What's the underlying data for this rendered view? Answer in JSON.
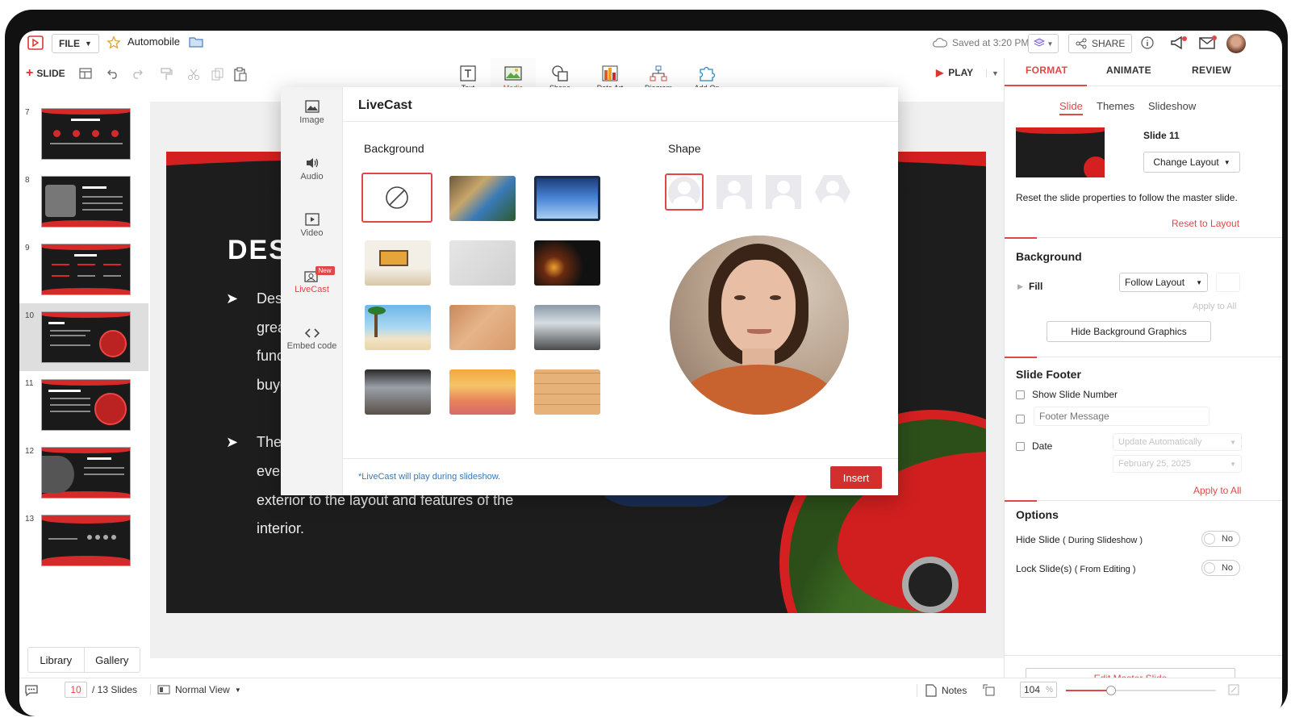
{
  "app": {
    "file_label": "FILE",
    "presentation_title": "Automobile",
    "saved_status": "Saved at 3:20 PM",
    "share_label": "SHARE"
  },
  "toolbar": {
    "slide_label": "SLIDE",
    "insert_tools": [
      {
        "label": "Text",
        "icon": "text-box-icon"
      },
      {
        "label": "Media",
        "icon": "image-icon"
      },
      {
        "label": "Shape",
        "icon": "shape-icon"
      },
      {
        "label": "Data Art",
        "icon": "data-art-icon"
      },
      {
        "label": "Diagram",
        "icon": "diagram-icon"
      },
      {
        "label": "Add-On",
        "icon": "puzzle-icon"
      }
    ],
    "play_label": "PLAY"
  },
  "panel": {
    "tabs": [
      "FORMAT",
      "ANIMATE",
      "REVIEW"
    ],
    "subtabs": [
      "Slide",
      "Themes",
      "Slideshow"
    ],
    "slide_name": "Slide 11",
    "change_layout": "Change Layout",
    "reset_text": "Reset the slide properties to follow the master slide.",
    "reset_link": "Reset to Layout",
    "background_title": "Background",
    "fill_label": "Fill",
    "fill_value": "Follow Layout",
    "apply_all": "Apply to All",
    "hide_bg_graphics": "Hide Background Graphics",
    "footer_title": "Slide Footer",
    "show_slide_number": "Show Slide Number",
    "footer_message_placeholder": "Footer Message",
    "date_label": "Date",
    "date_mode": "Update Automatically",
    "date_value": "February 25, 2025",
    "apply_all_2": "Apply to All",
    "options_title": "Options",
    "hide_slide": "Hide Slide",
    "hide_slide_note": "( During Slideshow )",
    "lock_slide": "Lock Slide(s)",
    "lock_slide_note": "( From Editing )",
    "toggle_no": "No",
    "edit_master": "Edit Master Slide"
  },
  "thumbnails": [
    "7",
    "8",
    "9",
    "10",
    "11",
    "12",
    "13"
  ],
  "slide": {
    "title": "DESI",
    "lines_a": [
      "Des",
      "grea",
      "func",
      "buye"
    ],
    "lines_b": [
      "The",
      "ever",
      "exterior to the layout and features of the",
      "interior."
    ]
  },
  "dialog": {
    "title": "LiveCast",
    "side": [
      {
        "label": "Image",
        "icon": "image-icon"
      },
      {
        "label": "Audio",
        "icon": "speaker-icon"
      },
      {
        "label": "Video",
        "icon": "video-icon"
      },
      {
        "label": "LiveCast",
        "icon": "livecast-icon",
        "badge": "New"
      },
      {
        "label": "Embed code",
        "icon": "code-icon"
      }
    ],
    "background_label": "Background",
    "shape_label": "Shape",
    "note": "*LiveCast will play during slideshow.",
    "insert_label": "Insert"
  },
  "status": {
    "current_slide": "10",
    "total_slides": "/ 13 Slides",
    "view_mode": "Normal View",
    "notes_label": "Notes",
    "zoom": "104",
    "zoom_unit": "%",
    "zoom_level_fraction": 0.3
  },
  "library": {
    "library_label": "Library",
    "gallery_label": "Gallery"
  },
  "colors": {
    "accent": "#e04848",
    "slide_red": "#d42020",
    "insert_button": "#d32f2f"
  }
}
